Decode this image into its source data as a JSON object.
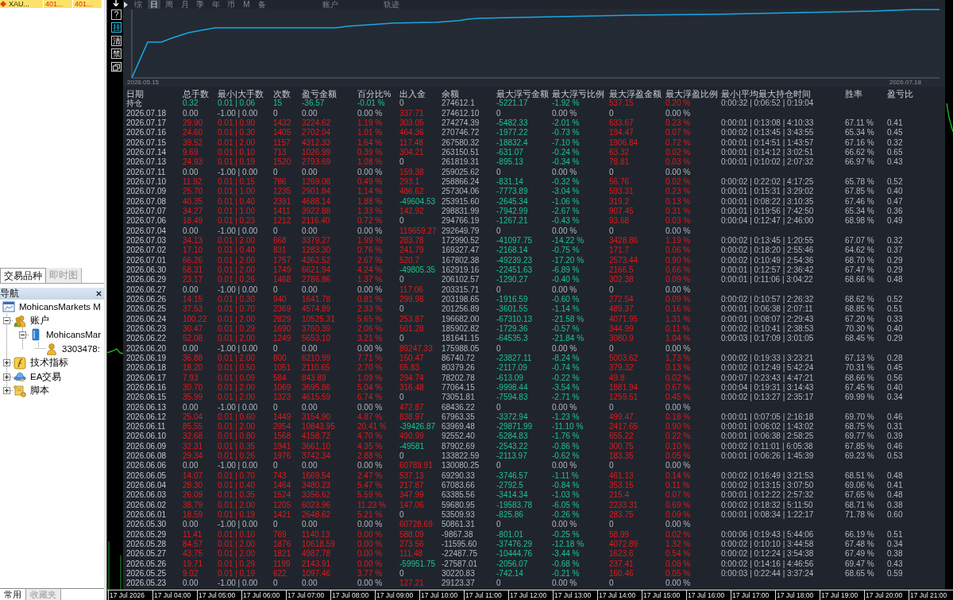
{
  "market_watch": {
    "symbol": "XAU...",
    "prices": [
      "401...",
      "401..."
    ]
  },
  "panel_tabs": [
    {
      "label": "交易品种",
      "selected": true
    },
    {
      "label": "即时图",
      "selected": false
    }
  ],
  "navigator": {
    "title": "导航",
    "tree": [
      {
        "label": "MohicansMarkets M",
        "kind": "broker",
        "children": [
          {
            "label": "账户",
            "kind": "accounts",
            "expanded": true,
            "children": [
              {
                "label": "MohicansMar",
                "kind": "server",
                "expanded": true,
                "children": [
                  {
                    "label": "3303478:",
                    "kind": "account"
                  }
                ]
              }
            ]
          },
          {
            "label": "技术指标",
            "kind": "indicators",
            "expanded": false
          },
          {
            "label": "EA交易",
            "kind": "experts",
            "expanded": false
          },
          {
            "label": "脚本",
            "kind": "scripts",
            "expanded": false
          }
        ]
      }
    ]
  },
  "bottom_tabs": [
    {
      "label": "常用",
      "selected": true
    },
    {
      "label": "收藏夹",
      "selected": false
    }
  ],
  "ea_panel": {
    "tools": [
      {
        "label": "?",
        "on": false
      },
      {
        "label": "挂",
        "on": true
      },
      {
        "label": "清",
        "on": false
      },
      {
        "label": "禁",
        "on": false
      }
    ],
    "period_tabs": [
      {
        "label": "综",
        "selected": false
      },
      {
        "label": "日",
        "selected": true
      },
      {
        "label": "周",
        "selected": false
      },
      {
        "label": "月",
        "selected": false
      },
      {
        "label": "季",
        "selected": false
      },
      {
        "label": "年",
        "selected": false
      },
      {
        "label": "币",
        "selected": false
      },
      {
        "label": "M",
        "selected": false
      },
      {
        "label": "备",
        "selected": false
      }
    ],
    "section_buttons": [
      "账户",
      "轨迹"
    ],
    "equity_chart": {
      "start_label": "2026.05.15",
      "end_label": "2026.07.18"
    },
    "table": {
      "columns": [
        "日期",
        "总手数",
        "最小|大手数",
        "次数",
        "盈亏金额",
        "百分比%",
        "出入金",
        "余额",
        "最大浮亏金额",
        "最大浮亏比例",
        "最大浮盈金额",
        "最大浮盈比例",
        "最小|平均最大持仓时间",
        "胜率",
        "盈亏比"
      ],
      "rows": [
        {
          "kind": "loss",
          "cells": [
            "持仓",
            "0.32",
            "0.01 | 0.06",
            "15",
            "-36.57",
            "-0.01 %",
            {
              "text": "0",
              "kind": "zero"
            },
            "274612.1",
            "-5221.17",
            "-1.92 %",
            "537.15",
            "0.20 %",
            "0:00:32 | 0:06:52 | 0:19:04"
          ]
        },
        {
          "kind": "idle",
          "cells": [
            "2026.07.18",
            "0.00",
            "-1.00 | 0.00",
            "0",
            "0.00",
            "0.00 %",
            {
              "text": "337.71",
              "kind": "deposit"
            },
            "274612.10",
            "0",
            "0.00 %",
            "0",
            "0.00 %"
          ]
        },
        {
          "kind": "profit",
          "cells": [
            "2026.07.17",
            "29.90",
            "0.01 | 0.90",
            "1432",
            "3224.62",
            "1.19 %",
            {
              "text": "303.05",
              "kind": "deposit"
            },
            "274274.39",
            "-5482.33",
            "-2.01 %",
            "633.67",
            "0.23 %",
            "0:00:01 | 0:13:08 | 4:10:33",
            "67.11 %",
            "0.41"
          ]
        },
        {
          "kind": "profit",
          "cells": [
            "2026.07.16",
            "24.60",
            "0.01 | 0.30",
            "1405",
            "2702.04",
            "1.01 %",
            {
              "text": "464.36",
              "kind": "deposit"
            },
            "270746.72",
            "-1977.22",
            "-0.73 %",
            "194.47",
            "0.07 %",
            "0:00:02 | 0:13:45 | 3:43:55",
            "65.34 %",
            "0.45"
          ]
        },
        {
          "kind": "profit",
          "cells": [
            "2026.07.15",
            "39.52",
            "0.01 | 2.00",
            "1157",
            "4312.33",
            "1.64 %",
            {
              "text": "117.48",
              "kind": "deposit"
            },
            "267580.32",
            "-18832.4",
            "-7.10 %",
            "1906.84",
            "0.72 %",
            "0:00:01 | 0:14:51 | 1:43:57",
            "67.16 %",
            "0.32"
          ]
        },
        {
          "kind": "profit",
          "cells": [
            "2026.07.14",
            "9.69",
            "0.01 | 0.10",
            "713",
            "1026.99",
            "0.39 %",
            {
              "text": "304.21",
              "kind": "deposit"
            },
            "263150.51",
            "-631.07",
            "-0.24 %",
            "63.32",
            "0.02 %",
            "0:00:01 | 0:14:12 | 3:02:51",
            "66.62 %",
            "0.65"
          ]
        },
        {
          "kind": "profit",
          "cells": [
            "2026.07.13",
            "24.93",
            "0.01 | 0.19",
            "1520",
            "2793.69",
            "1.08 %",
            {
              "text": "0",
              "kind": "zero"
            },
            "261819.31",
            "-895.13",
            "-0.34 %",
            "78.81",
            "0.03 %",
            "0:00:01 | 0:10:02 | 2:07:32",
            "66.97 %",
            "0.43"
          ]
        },
        {
          "kind": "idle",
          "cells": [
            "2026.07.11",
            "0.00",
            "-1.00 | 0.00",
            "0",
            "0.00",
            "0.00 %",
            {
              "text": "159.38",
              "kind": "deposit"
            },
            "259025.62",
            "0",
            "0.00 %",
            "0",
            "0.00 %"
          ]
        },
        {
          "kind": "profit",
          "cells": [
            "2026.07.10",
            "11.92",
            "0.01 | 0.15",
            "786",
            "1269.08",
            "0.49 %",
            {
              "text": "293.1",
              "kind": "deposit"
            },
            "258866.24",
            "-831.14",
            "-0.32 %",
            "56.76",
            "0.02 %",
            "0:00:02 | 0:22:02 | 4:17:25",
            "65.78 %",
            "0.52"
          ]
        },
        {
          "kind": "profit",
          "cells": [
            "2026.07.09",
            "25.70",
            "0.01 | 1.00",
            "1235",
            "2901.84",
            "1.14 %",
            {
              "text": "486.62",
              "kind": "deposit"
            },
            "257304.06",
            "-7773.89",
            "-3.04 %",
            "593.31",
            "0.23 %",
            "0:00:01 | 0:15:31 | 3:29:02",
            "67.85 %",
            "0.40"
          ]
        },
        {
          "kind": "profit",
          "cells": [
            "2026.07.08",
            "40.35",
            "0.01 | 0.40",
            "2391",
            "4688.14",
            "1.88 %",
            {
              "text": "-49604.53",
              "kind": "withdrawal"
            },
            "253915.60",
            "-2645.34",
            "-1.06 %",
            "319.2",
            "0.13 %",
            "0:00:01 | 0:08:22 | 3:10:35",
            "67.46 %",
            "0.47"
          ]
        },
        {
          "kind": "profit",
          "cells": [
            "2026.07.07",
            "34.27",
            "0.01 | 1.00",
            "1411",
            "3922.88",
            "1.33 %",
            {
              "text": "142.92",
              "kind": "deposit"
            },
            "298831.99",
            "-7942.99",
            "-2.67 %",
            "907.45",
            "0.31 %",
            "0:00:01 | 0:19:56 | 7:42:50",
            "65.34 %",
            "0.36"
          ]
        },
        {
          "kind": "profit",
          "cells": [
            "2026.07.06",
            "18.49",
            "0.01 | 0.23",
            "1212",
            "2116.40",
            "0.72 %",
            {
              "text": "0",
              "kind": "zero"
            },
            "294766.19",
            "-1267.21",
            "-0.43 %",
            "93.68",
            "0.03 %",
            "0:00:04 | 0:12:47 | 2:46:00",
            "68.98 %",
            "0.49"
          ]
        },
        {
          "kind": "idle",
          "cells": [
            "2026.07.04",
            "0.00",
            "-1.00 | 0.00",
            "0",
            "0.00",
            "0.00 %",
            {
              "text": "119659.27",
              "kind": "deposit"
            },
            "292649.79",
            "0",
            "0.00 %",
            "0",
            "0.00 %"
          ]
        },
        {
          "kind": "profit",
          "cells": [
            "2026.07.03",
            "34.13",
            "0.01 | 2.00",
            "668",
            "3379.27",
            "1.99 %",
            {
              "text": "283.78",
              "kind": "deposit"
            },
            "172990.52",
            "-41097.75",
            "-14.22 %",
            "3428.86",
            "1.19 %",
            "0:00:02 | 0:13:45 | 1:20:55",
            "67.07 %",
            "0.32"
          ]
        },
        {
          "kind": "profit",
          "cells": [
            "2026.07.02",
            "17.10",
            "0.01 | 0.40",
            "831",
            "1283.30",
            "0.76 %",
            {
              "text": "241.79",
              "kind": "deposit"
            },
            "169327.47",
            "-2168.14",
            "-0.75 %",
            "171.7",
            "0.06 %",
            "0:00:02 | 0:18:20 | 2:55:46",
            "64.62 %",
            "0.37"
          ]
        },
        {
          "kind": "profit",
          "cells": [
            "2026.07.01",
            "66.26",
            "0.01 | 2.00",
            "1757",
            "4362.52",
            "2.67 %",
            {
              "text": "520.7",
              "kind": "deposit"
            },
            "167802.38",
            "-49239.23",
            "-17.20 %",
            "2573.44",
            "0.90 %",
            "0:00:02 | 0:10:49 | 2:54:36",
            "68.70 %",
            "0.29"
          ]
        },
        {
          "kind": "profit",
          "cells": [
            "2026.06.30",
            "58.31",
            "0.01 | 2.00",
            "1749",
            "6621.94",
            "4.24 %",
            {
              "text": "-49805.35",
              "kind": "withdrawal"
            },
            "162919.16",
            "-22451.63",
            "-6.89 %",
            "2166.5",
            "0.66 %",
            "0:00:01 | 0:12:57 | 2:36:42",
            "67.47 %",
            "0.29"
          ]
        },
        {
          "kind": "profit",
          "cells": [
            "2026.06.29",
            "23.17",
            "0.01 | 0.26",
            "1468",
            "2786.86",
            "1.37 %",
            {
              "text": "0",
              "kind": "zero"
            },
            "206102.57",
            "-1290.27",
            "-0.40 %",
            "302.38",
            "0.09 %",
            "0:00:01 | 0:11:06 | 3:04:22",
            "68.66 %",
            "0.48"
          ]
        },
        {
          "kind": "idle",
          "cells": [
            "2026.06.27",
            "0.00",
            "-1.00 | 0.00",
            "0",
            "0.00",
            "0.00 %",
            {
              "text": "117.06",
              "kind": "deposit"
            },
            "203315.71",
            "0",
            "0.00 %",
            "0",
            "0.00 %"
          ]
        },
        {
          "kind": "profit",
          "cells": [
            "2026.06.26",
            "14.15",
            "0.01 | 0.30",
            "940",
            "1641.78",
            "0.81 %",
            {
              "text": "299.98",
              "kind": "deposit"
            },
            "203198.65",
            "-1916.59",
            "-0.60 %",
            "272.54",
            "0.09 %",
            "0:00:02 | 0:10:57 | 2:26:32",
            "68.62 %",
            "0.52"
          ]
        },
        {
          "kind": "profit",
          "cells": [
            "2026.06.25",
            "37.53",
            "0.01 | 0.70",
            "2369",
            "4574.89",
            "2.33 %",
            {
              "text": "0",
              "kind": "zero"
            },
            "201256.89",
            "-3601.55",
            "-1.14 %",
            "489.37",
            "0.16 %",
            "0:00:01 | 0:06:38 | 2:07:11",
            "68.85 %",
            "0.51"
          ]
        },
        {
          "kind": "profit",
          "cells": [
            "2026.06.24",
            "100.22",
            "0.01 | 2.00",
            "2829",
            "10525.31",
            "5.65 %",
            {
              "text": "253.87",
              "kind": "deposit"
            },
            "196682.00",
            "-67310.13",
            "-21.58 %",
            "4071.95",
            "1.31 %",
            "0:00:01 | 0:08:07 | 2:29:43",
            "67.20 %",
            "0.33"
          ]
        },
        {
          "kind": "profit",
          "cells": [
            "2026.06.23",
            "30.47",
            "0.01 | 0.29",
            "1690",
            "3760.39",
            "2.06 %",
            {
              "text": "501.28",
              "kind": "deposit"
            },
            "185902.82",
            "-1729.36",
            "-0.57 %",
            "344.99",
            "0.11 %",
            "0:00:02 | 0:10:41 | 2:38:53",
            "70.30 %",
            "0.40"
          ]
        },
        {
          "kind": "profit",
          "cells": [
            "2026.06.22",
            "52.08",
            "0.01 | 2.00",
            "1249",
            "5653.10",
            "3.21 %",
            {
              "text": "0",
              "kind": "zero"
            },
            "181641.15",
            "-64535.3",
            "-21.84 %",
            "3080.9",
            "1.04 %",
            "0:00:03 | 0:17:09 | 3:01:05",
            "68.45 %",
            "0.29"
          ]
        },
        {
          "kind": "idle",
          "cells": [
            "2026.06.20",
            "0.00",
            "-1.00 | 0.00",
            "0",
            "0.00",
            "0.00 %",
            {
              "text": "89247.33",
              "kind": "deposit"
            },
            "175988.05",
            "0",
            "0.00 %",
            "0",
            "0.00 %"
          ]
        },
        {
          "kind": "profit",
          "cells": [
            "2026.06.19",
            "36.88",
            "0.01 | 2.00",
            "800",
            "6210.99",
            "7.71 %",
            {
              "text": "150.47",
              "kind": "deposit"
            },
            "86740.72",
            "-23827.11",
            "-8.24 %",
            "5003.62",
            "1.73 %",
            "0:00:02 | 0:19:33 | 3:23:21",
            "67.13 %",
            "0.28"
          ]
        },
        {
          "kind": "profit",
          "cells": [
            "2026.06.18",
            "18.20",
            "0.01 | 0.50",
            "1051",
            "2110.65",
            "2.70 %",
            {
              "text": "65.83",
              "kind": "deposit"
            },
            "80379.26",
            "-2117.09",
            "-0.74 %",
            "379.32",
            "0.13 %",
            "0:00:02 | 0:12:49 | 5:42:24",
            "70.31 %",
            "0.45"
          ]
        },
        {
          "kind": "profit",
          "cells": [
            "2026.06.17",
            "7.93",
            "0.01 | 0.09",
            "584",
            "843.89",
            "1.09 %",
            {
              "text": "294.74",
              "kind": "deposit"
            },
            "78202.78",
            "-613.09",
            "-0.22 %",
            "49.8",
            "0.02 %",
            "0:00:07 | 0:23:43 | 4:47:21",
            "68.66 %",
            "0.56"
          ]
        },
        {
          "kind": "profit",
          "cells": [
            "2026.06.16",
            "30.70",
            "0.01 | 2.00",
            "1069",
            "3695.86",
            "5.04 %",
            {
              "text": "316.48",
              "kind": "deposit"
            },
            "77064.15",
            "-9998.44",
            "-3.54 %",
            "1881.94",
            "0.67 %",
            "0:00:04 | 0:19:31 | 3:14:43",
            "67.45 %",
            "0.40"
          ]
        },
        {
          "kind": "profit",
          "cells": [
            "2026.06.15",
            "35.99",
            "0.01 | 2.00",
            "1323",
            "4615.59",
            "6.74 %",
            {
              "text": "0",
              "kind": "zero"
            },
            "73051.81",
            "-7594.83",
            "-2.71 %",
            "1259.51",
            "0.45 %",
            "0:00:02 | 0:13:27 | 2:35:17",
            "69.99 %",
            "0.34"
          ]
        },
        {
          "kind": "idle",
          "cells": [
            "2026.06.13",
            "0.00",
            "-1.00 | 0.00",
            "0",
            "0.00",
            "0.00 %",
            {
              "text": "472.87",
              "kind": "deposit"
            },
            "68436.22",
            "0",
            "0.00 %",
            "0",
            "0.00 %"
          ]
        },
        {
          "kind": "profit",
          "cells": [
            "2026.06.12",
            "25.04",
            "0.01 | 0.60",
            "1449",
            "3154.90",
            "4.87 %",
            {
              "text": "838.97",
              "kind": "deposit"
            },
            "67963.35",
            "-3372.94",
            "-1.23 %",
            "499.47",
            "0.18 %",
            "0:00:01 | 0:07:05 | 2:16:18",
            "69.70 %",
            "0.46"
          ]
        },
        {
          "kind": "profit",
          "cells": [
            "2026.06.11",
            "85.55",
            "0.01 | 2.00",
            "2954",
            "10843.95",
            "20.41 %",
            {
              "text": "-39426.87",
              "kind": "withdrawal"
            },
            "63969.48",
            "-29871.99",
            "-11.10 %",
            "2417.65",
            "0.90 %",
            "0:00:01 | 0:06:02 | 1:43:02",
            "68.75 %",
            "0.31"
          ]
        },
        {
          "kind": "profit",
          "cells": [
            "2026.06.10",
            "32.68",
            "0.01 | 0.80",
            "1568",
            "4158.72",
            "4.70 %",
            {
              "text": "490.99",
              "kind": "deposit"
            },
            "92552.40",
            "-5284.83",
            "-1.76 %",
            "655.22",
            "0.22 %",
            "0:00:01 | 0:06:38 | 2:58:25",
            "69.77 %",
            "0.39"
          ]
        },
        {
          "kind": "profit",
          "cells": [
            "2026.06.09",
            "32.31",
            "0.01 | 0.35",
            "1941",
            "3661.10",
            "4.35 %",
            {
              "text": "-49581",
              "kind": "withdrawal"
            },
            "87902.69",
            "-2543.22",
            "-0.86 %",
            "300.75",
            "0.10 %",
            "0:00:02 | 0:11:01 | 6:05:38",
            "67.85 %",
            "0.46"
          ]
        },
        {
          "kind": "profit",
          "cells": [
            "2026.06.08",
            "29.34",
            "0.01 | 0.26",
            "1976",
            "3742.34",
            "2.88 %",
            {
              "text": "0",
              "kind": "zero"
            },
            "133822.59",
            "-2113.97",
            "-0.62 %",
            "183.35",
            "0.05 %",
            "0:00:01 | 0:06:26 | 1:45:39",
            "69.23 %",
            "0.53"
          ]
        },
        {
          "kind": "idle",
          "cells": [
            "2026.06.06",
            "0.00",
            "-1.00 | 0.00",
            "0",
            "0.00",
            "0.00 %",
            {
              "text": "60789.91",
              "kind": "deposit"
            },
            "130080.25",
            "0",
            "0.00 %",
            "0",
            "0.00 %"
          ]
        },
        {
          "kind": "profit",
          "cells": [
            "2026.06.05",
            "14.07",
            "0.01 | 0.70",
            "743",
            "1669.54",
            "2.47 %",
            {
              "text": "537.13",
              "kind": "deposit"
            },
            "69290.33",
            "-3746.57",
            "-1.11 %",
            "461.13",
            "0.14 %",
            "0:00:02 | 0:16:49 | 3:21:53",
            "68.51 %",
            "0.48"
          ]
        },
        {
          "kind": "profit",
          "cells": [
            "2026.06.04",
            "28.30",
            "0.01 | 0.40",
            "1464",
            "3480.23",
            "5.47 %",
            {
              "text": "217.87",
              "kind": "deposit"
            },
            "67083.66",
            "-2792.5",
            "-0.84 %",
            "353.15",
            "0.11 %",
            "0:00:02 | 0:13:15 | 3:07:50",
            "69.06 %",
            "0.41"
          ]
        },
        {
          "kind": "profit",
          "cells": [
            "2026.06.03",
            "26.09",
            "0.01 | 0.35",
            "1524",
            "3356.62",
            "5.59 %",
            {
              "text": "347.99",
              "kind": "deposit"
            },
            "63385.56",
            "-3414.34",
            "-1.03 %",
            "215.4",
            "0.07 %",
            "0:00:01 | 0:12:22 | 2:57:32",
            "67.65 %",
            "0.48"
          ]
        },
        {
          "kind": "profit",
          "cells": [
            "2026.06.02",
            "38.79",
            "0.01 | 2.00",
            "1205",
            "6023.96",
            "11.23 %",
            {
              "text": "147.06",
              "kind": "deposit"
            },
            "59680.95",
            "-19583.78",
            "-6.05 %",
            "2233.31",
            "0.69 %",
            "0:00:02 | 0:18:32 | 5:11:50",
            "68.71 %",
            "0.38"
          ]
        },
        {
          "kind": "profit",
          "cells": [
            "2026.06.01",
            "18.59",
            "0.01 | 0.19",
            "1421",
            "2648.62",
            "5.21 %",
            {
              "text": "0",
              "kind": "zero"
            },
            "53509.93",
            "-825.86",
            "-0.26 %",
            "283.75",
            "0.09 %",
            "0:00:01 | 0:08:34 | 1:22:17",
            "71.78 %",
            "0.60"
          ]
        },
        {
          "kind": "idle",
          "cells": [
            "2026.05.30",
            "0.00",
            "-1.00 | 0.00",
            "0",
            "0.00",
            "0.00 %",
            {
              "text": "60728.69",
              "kind": "deposit"
            },
            "50861.31",
            "0",
            "0.00 %",
            "0",
            "0.00 %"
          ]
        },
        {
          "kind": "profit",
          "cells": [
            "2026.05.29",
            "11.41",
            "0.01 | 0.10",
            "769",
            "1140.13",
            "0.00 %",
            {
              "text": "588.09",
              "kind": "deposit"
            },
            "-9867.38",
            "-801.01",
            "-0.25 %",
            "58.99",
            "0.02 %",
            "0:00:06 | 0:19:43 | 5:44:06",
            "66.19 %",
            "0.51"
          ]
        },
        {
          "kind": "profit",
          "cells": [
            "2026.05.28",
            "84.57",
            "0.01 | 2.00",
            "1876",
            "10618.59",
            "0.00 %",
            {
              "text": "273.56",
              "kind": "deposit"
            },
            "-11595.60",
            "-37476.29",
            "-12.18 %",
            "4072.89",
            "1.32 %",
            "0:00:02 | 0:10:10 | 3:44:58",
            "67.48 %",
            "0.34"
          ]
        },
        {
          "kind": "profit",
          "cells": [
            "2026.05.27",
            "43.75",
            "0.01 | 2.00",
            "1821",
            "4987.78",
            "0.00 %",
            {
              "text": "111.48",
              "kind": "deposit"
            },
            "-22487.75",
            "-10444.76",
            "-3.44 %",
            "1623.6",
            "0.54 %",
            "0:00:02 | 0:12:24 | 3:54:38",
            "67.49 %",
            "0.38"
          ]
        },
        {
          "kind": "profit",
          "cells": [
            "2026.05.26",
            "19.71",
            "0.01 | 0.29",
            "1199",
            "2143.91",
            "0.00 %",
            {
              "text": "-59951.75",
              "kind": "withdrawal"
            },
            "-27587.01",
            "-2056.07",
            "-0.68 %",
            "237.41",
            "0.08 %",
            "0:00:02 | 0:14:16 | 4:46:56",
            "69.47 %",
            "0.43"
          ]
        },
        {
          "kind": "profit",
          "cells": [
            "2026.05.25",
            "9.02",
            "0.01 | 0.19",
            "622",
            "1097.46",
            "3.77 %",
            {
              "text": "0",
              "kind": "zero"
            },
            "30220.83",
            "-742.14",
            "-0.21 %",
            "160.46",
            "0.05 %",
            "0:00:03 | 0:22:44 | 3:37:24",
            "68.65 %",
            "0.59"
          ]
        },
        {
          "kind": "idle",
          "cells": [
            "2026.05.23",
            "0.00",
            "-1.00 | 0.00",
            "0",
            "0.00",
            "0.00 %",
            {
              "text": "127.21",
              "kind": "deposit"
            },
            "29123.37",
            "0",
            "0.00 %",
            "0",
            "0.00 %"
          ]
        }
      ]
    }
  },
  "time_axis": {
    "labels": [
      "17 Jul 2026",
      "17 Jul 04:00",
      "17 Jul 05:00",
      "17 Jul 06:00",
      "17 Jul 07:00",
      "17 Jul 08:00",
      "17 Jul 09:00",
      "17 Jul 10:00",
      "17 Jul 11:00",
      "17 Jul 12:00",
      "17 Jul 13:00",
      "17 Jul 14:00",
      "17 Jul 15:00",
      "17 Jul 16:00",
      "17 Jul 17:00",
      "17 Jul 18:00",
      "17 Jul 19:00",
      "17 Jul 20:00",
      "17 Jul 21:00"
    ]
  }
}
